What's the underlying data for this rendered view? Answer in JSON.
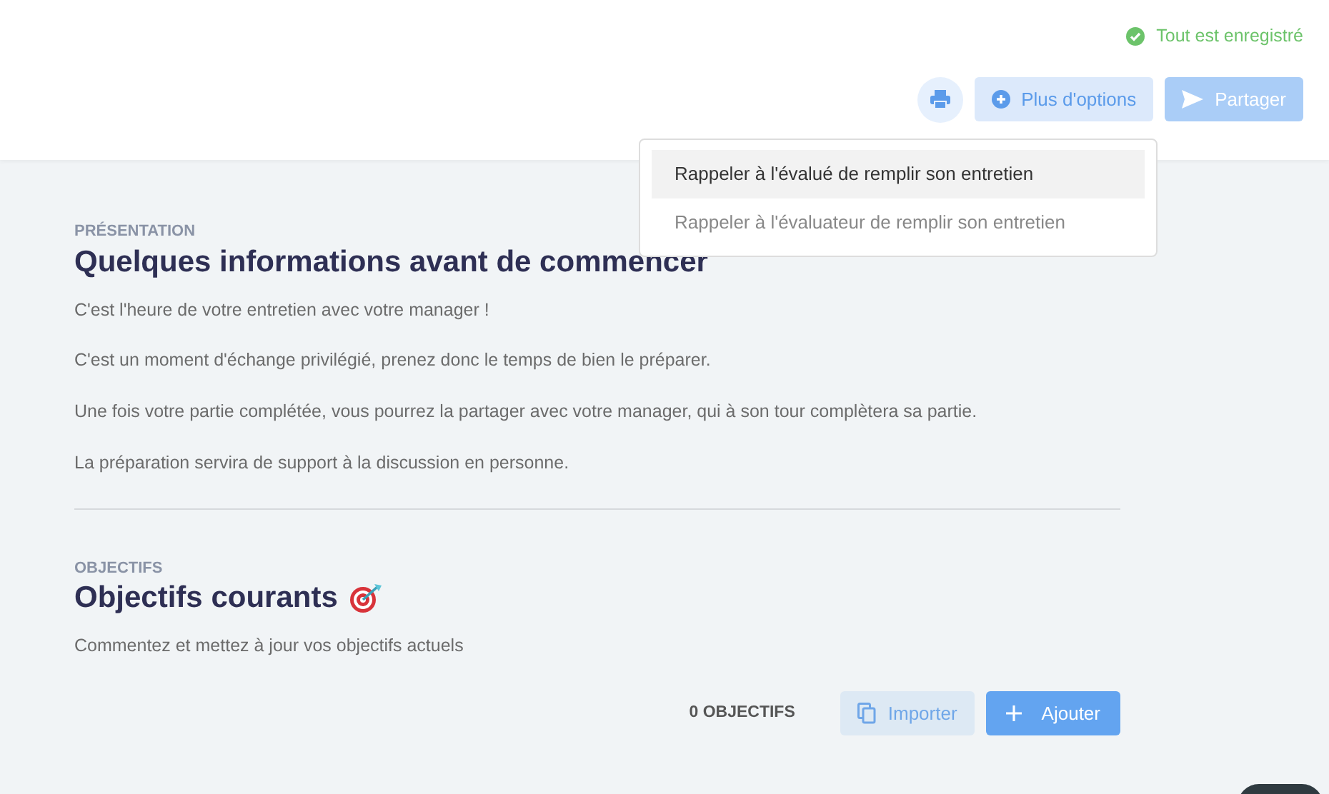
{
  "save_status": {
    "text": "Tout est enregistré",
    "saved": true
  },
  "toolbar": {
    "more_options": "Plus d'options",
    "share": {
      "label": "Partager",
      "disabled": true
    }
  },
  "menu": [
    {
      "label": "Rappeler à l'évalué de remplir son entretien",
      "selected": true
    },
    {
      "label": "Rappeler à l'évaluateur de remplir son entretien",
      "selected": false
    }
  ],
  "sections": [
    {
      "kind": "intro",
      "eyebrow": "PRÉSENTATION",
      "title": "Quelques informations avant de commencer",
      "paragraphs": [
        "C'est l'heure de votre entretien avec votre manager !",
        "C'est un moment d'échange privilégié, prenez donc le temps de bien le préparer.",
        "Une fois votre partie complétée, vous pourrez la partager avec votre manager, qui à son tour complètera sa partie.",
        "La préparation servira de support à la discussion en personne."
      ]
    },
    {
      "kind": "objectives",
      "eyebrow": "OBJECTIFS",
      "title": "Objectifs courants",
      "paragraphs": [
        "Commentez et mettez à jour vos objectifs actuels"
      ],
      "count": "0 OBJECTIFS",
      "import": "Importer",
      "add": "Ajouter"
    }
  ]
}
